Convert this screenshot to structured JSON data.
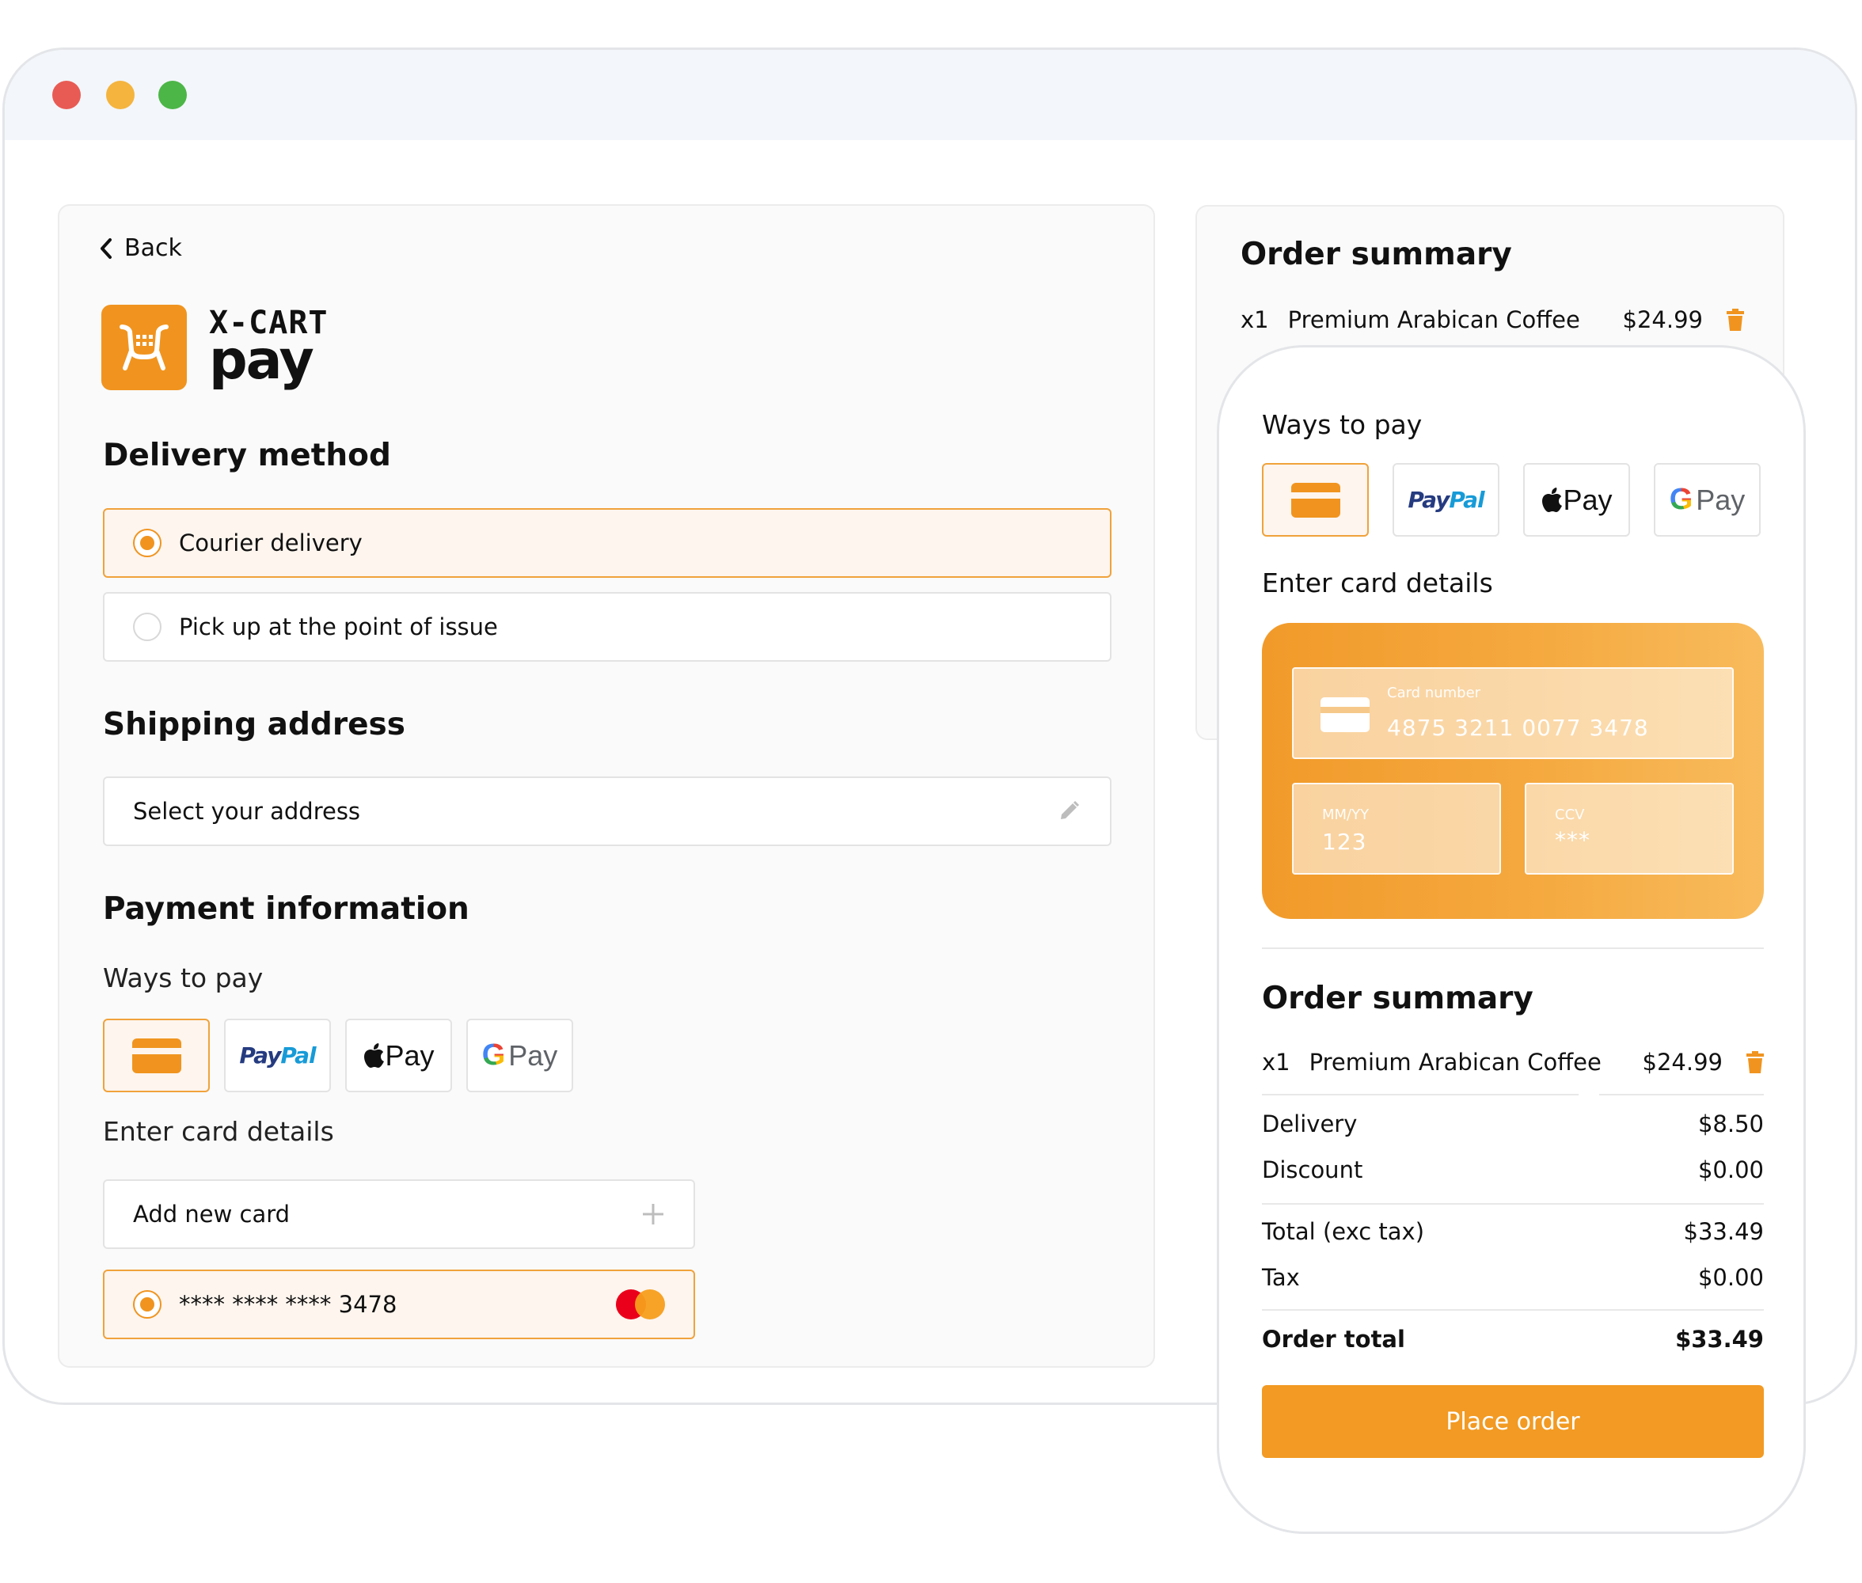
{
  "colors": {
    "accent": "#f0941f",
    "selected_bg": "#fdf5ee",
    "border": "#e3e3e3"
  },
  "checkout": {
    "back_label": "Back",
    "brand": {
      "line1": "X-CART",
      "line2": "pay"
    },
    "delivery": {
      "heading": "Delivery method",
      "options": [
        {
          "label": "Courier delivery",
          "selected": true
        },
        {
          "label": "Pick up at the point of issue",
          "selected": false
        }
      ]
    },
    "shipping": {
      "heading": "Shipping address",
      "placeholder": "Select your address"
    },
    "payment": {
      "heading": "Payment information",
      "ways_label": "Ways to pay",
      "methods": [
        {
          "name": "card",
          "icon": "credit-card-icon",
          "selected": true
        },
        {
          "name": "paypal",
          "text_a": "Pay",
          "text_b": "Pal"
        },
        {
          "name": "apple-pay",
          "text": "Pay"
        },
        {
          "name": "google-pay",
          "g": "G",
          "text": "Pay"
        }
      ],
      "card_details_label": "Enter card details",
      "add_card_label": "Add new card",
      "saved_card": "**** **** **** 3478"
    }
  },
  "summary_bg": {
    "title": "Order summary",
    "item": {
      "qty": "x1",
      "name": "Premium Arabican Coffee",
      "price": "$24.99"
    }
  },
  "mobile": {
    "ways_label": "Ways to pay",
    "card_details_label": "Enter card details",
    "card": {
      "number_label": "Card number",
      "number_value": "4875 3211 0077 3478",
      "expiry_label": "MM/YY",
      "expiry_value": "123",
      "ccv_label": "CCV",
      "ccv_value": "***"
    },
    "summary": {
      "title": "Order summary",
      "item": {
        "qty": "x1",
        "name": "Premium Arabican Coffee",
        "price": "$24.99"
      },
      "delivery_label": "Delivery",
      "delivery_value": "$8.50",
      "discount_label": "Discount",
      "discount_value": "$0.00",
      "total_exc_label": "Total (exc tax)",
      "total_exc_value": "$33.49",
      "tax_label": "Tax",
      "tax_value": "$0.00",
      "order_total_label": "Order total",
      "order_total_value": "$33.49"
    },
    "place_order_label": "Place order"
  }
}
